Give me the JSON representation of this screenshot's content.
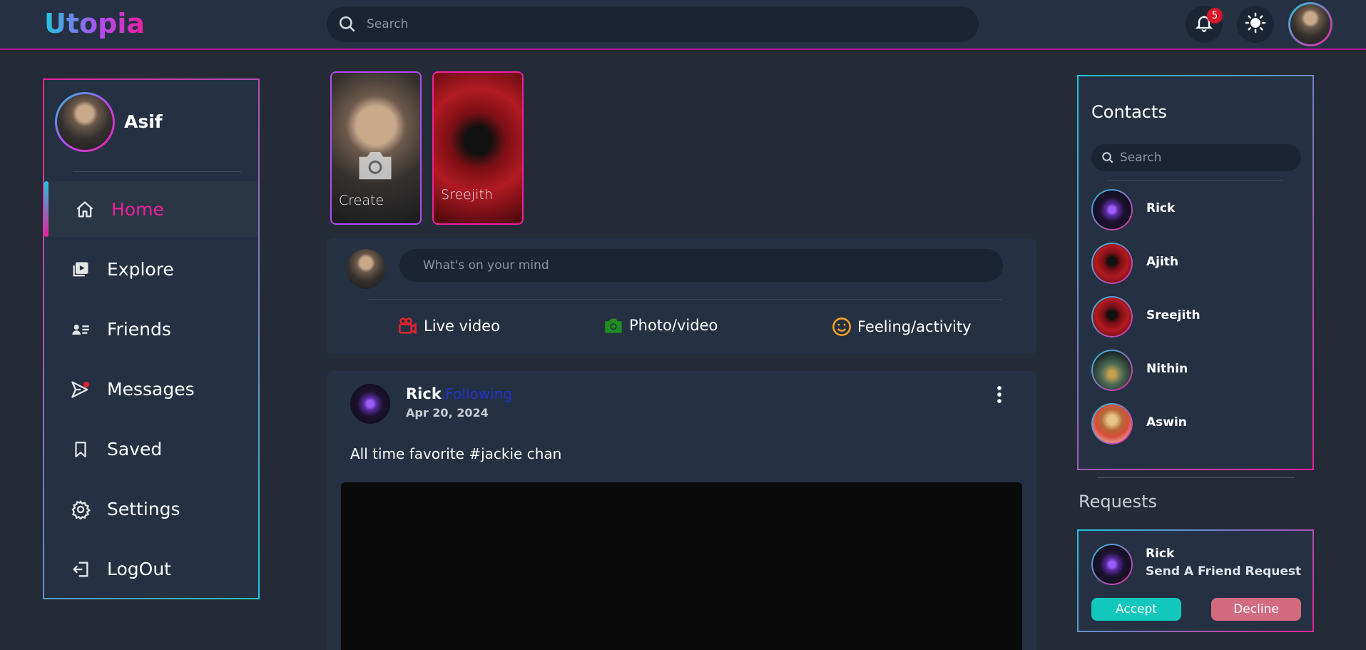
{
  "header": {
    "logo": "Utopia",
    "search_placeholder": "Search",
    "notification_count": "5",
    "icons": {
      "search": "search-icon",
      "bell": "bell-icon",
      "theme": "sun-icon"
    }
  },
  "sidebar": {
    "profile_name": "Asif",
    "items": [
      {
        "label": "Home",
        "icon": "home-icon",
        "active": true
      },
      {
        "label": "Explore",
        "icon": "explore-icon"
      },
      {
        "label": "Friends",
        "icon": "friends-icon"
      },
      {
        "label": "Messages",
        "icon": "messages-icon"
      },
      {
        "label": "Saved",
        "icon": "bookmark-icon"
      },
      {
        "label": "Settings",
        "icon": "gear-icon"
      },
      {
        "label": "LogOut",
        "icon": "logout-icon"
      }
    ]
  },
  "stories": [
    {
      "label": "Create",
      "icon": "camera-icon"
    },
    {
      "label": "Sreejith"
    }
  ],
  "composer": {
    "placeholder": "What's on your mind",
    "actions": [
      {
        "label": "Live video",
        "icon": "video-camera-icon",
        "color": "#e0232f"
      },
      {
        "label": "Photo/video",
        "icon": "camera-icon",
        "color": "#1e8e1e"
      },
      {
        "label": "Feeling/activity",
        "icon": "smile-icon",
        "color": "#f0a21a"
      }
    ]
  },
  "post": {
    "author": "Rick",
    "follow_label": ".Following",
    "date": "Apr 20, 2024",
    "text": "All time favorite #jackie chan",
    "menu_icon": "more-vertical-icon"
  },
  "contacts": {
    "title": "Contacts",
    "search_placeholder": "Search",
    "items": [
      {
        "name": "Rick"
      },
      {
        "name": "Ajith"
      },
      {
        "name": "Sreejith"
      },
      {
        "name": "Nithin"
      },
      {
        "name": "Aswin"
      }
    ]
  },
  "requests": {
    "title": "Requests",
    "items": [
      {
        "name": "Rick",
        "message": "Send A Friend Request",
        "accept_label": "Accept",
        "decline_label": "Decline"
      }
    ]
  },
  "colors": {
    "accent_pink": "#ec1f9c",
    "accent_cyan": "#1fc6e0",
    "background": "#242b37",
    "panel": "#253143"
  }
}
